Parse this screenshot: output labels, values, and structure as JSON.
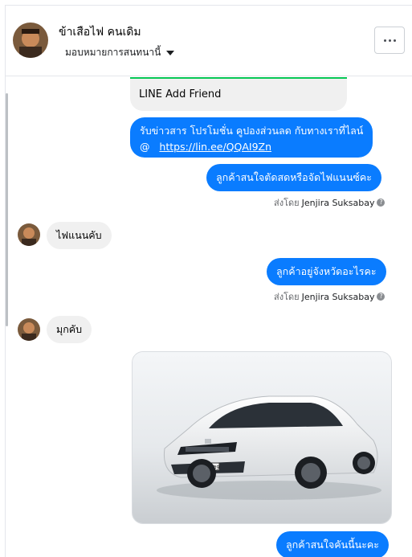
{
  "header": {
    "name": "ข้าเสือไฟ คนเดิม",
    "subtitle": "มอบหมายการสนทนานี้",
    "more_icon": "more-icon"
  },
  "messages": {
    "card_title": "LINE Add Friend",
    "promo_line1": "รับข่าวสาร  โปรโมชั่น คูปองส่วนลด กับทางเราที่ไลน์",
    "promo_prefix": "@",
    "promo_link": "https://lin.ee/QQAI9Zn",
    "ask_install": "ลูกค้าสนใจตัดสดหรือจัดไฟแนนซ์คะ",
    "sentby_label_1": "ส่งโดย",
    "sentby_name_1": "Jenjira Suksabay",
    "reply_finance": "ไฟแนนคับ",
    "ask_province": "ลูกค้าอยู่จังหวัดอะไรคะ",
    "sentby_label_2": "ส่งโดย",
    "sentby_name_2": "Jenjira Suksabay",
    "reply_mukdahan": "มุกคับ",
    "plate": "6กษ 6039",
    "ask_car": "ลูกค้าสนใจคันนี้นะคะ"
  },
  "colors": {
    "outgoing": "#0a7cff",
    "incoming": "#f0f0f0",
    "line_green": "#06c755"
  }
}
